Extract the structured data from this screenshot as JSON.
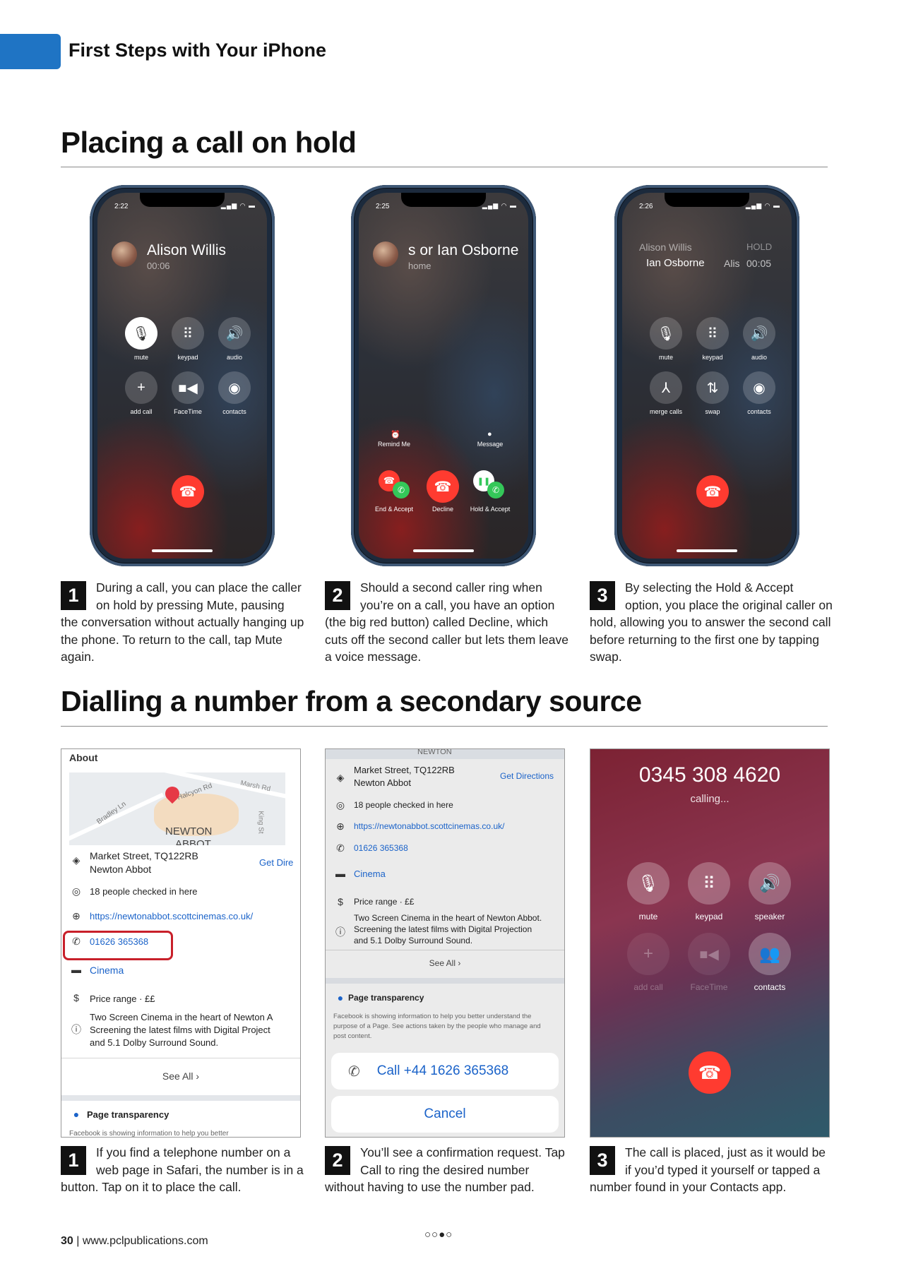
{
  "header": {
    "section_title": "First Steps with Your iPhone"
  },
  "section1": {
    "title": "Placing a call on hold"
  },
  "section2": {
    "title": "Dialling a number from a secondary source"
  },
  "colors": {
    "accent_tab": "#1f74c4",
    "end_call_red": "#ff3b30",
    "accept_green": "#34c759",
    "link_blue": "#1b63c9",
    "highlight_red": "#c8202a"
  },
  "phone1": {
    "time": "2:22",
    "status_icons": "signal wifi battery",
    "caller_name": "Alison Willis",
    "duration": "00:06",
    "buttons": [
      {
        "icon": "mic-off-icon",
        "label": "mute"
      },
      {
        "icon": "keypad-icon",
        "label": "keypad"
      },
      {
        "icon": "speaker-icon",
        "label": "audio"
      },
      {
        "icon": "plus-icon",
        "label": "add call"
      },
      {
        "icon": "video-icon",
        "label": "FaceTime"
      },
      {
        "icon": "contacts-icon",
        "label": "contacts"
      }
    ],
    "end_icon": "end-call-icon"
  },
  "phone2": {
    "time": "2:25",
    "caller_name": "s or Ian Osborne",
    "subtitle": "home",
    "remind_label": "Remind Me",
    "message_label": "Message",
    "end_accept_label": "End & Accept",
    "decline_label": "Decline",
    "hold_accept_label": "Hold & Accept"
  },
  "phone3": {
    "time": "2:26",
    "held_name": "Alison Willis",
    "held_status": "HOLD",
    "active_name": "Ian Osborne",
    "active_short": "Alis",
    "duration": "00:05",
    "buttons": [
      {
        "icon": "mic-off-icon",
        "label": "mute"
      },
      {
        "icon": "keypad-icon",
        "label": "keypad"
      },
      {
        "icon": "speaker-icon",
        "label": "audio"
      },
      {
        "icon": "merge-icon",
        "label": "merge calls"
      },
      {
        "icon": "swap-icon",
        "label": "swap"
      },
      {
        "icon": "contacts-icon",
        "label": "contacts"
      }
    ]
  },
  "steps1": [
    {
      "num": "1",
      "text": "During a call, you can place the caller on hold by pressing Mute, pausing the conversation without actually hanging up the phone. To return to the call, tap Mute again."
    },
    {
      "num": "2",
      "text": "Should a second caller ring when you’re on a call, you have an option (the big red button) called Decline, which cuts off the second caller but lets them leave a voice message."
    },
    {
      "num": "3",
      "text": "By selecting the Hold & Accept option, you place the original caller on hold, allowing you to answer the second call before returning to the first one by tapping swap."
    }
  ],
  "shot1": {
    "about": "About",
    "map_labels": [
      "Bradley Ln",
      "Halcyon Rd",
      "Marsh Rd",
      "NEWTON",
      "ABBOT",
      "King St"
    ],
    "address_line1": "Market Street, TQ122RB",
    "address_line2": "Newton Abbot",
    "directions": "Get Dire",
    "checked_in": "18 people checked in here",
    "website": "https://newtonabbot.scottcinemas.co.uk/",
    "phone": "01626 365368",
    "category": "Cinema",
    "price": "Price range · ££",
    "desc1": "Two Screen Cinema in the heart of Newton A",
    "desc2": "Screening the latest films with Digital Project",
    "desc3": "and 5.1 Dolby Surround Sound.",
    "see_all": "See All",
    "transparency": "Page transparency",
    "cut_text": "Facebook is showing information to help you better"
  },
  "shot2": {
    "map_top": "NEWTON",
    "address_line1": "Market Street, TQ122RB",
    "address_line2": "Newton Abbot",
    "directions": "Get Directions",
    "checked_in": "18 people checked in here",
    "website": "https://newtonabbot.scottcinemas.co.uk/",
    "phone": "01626 365368",
    "category": "Cinema",
    "price": "Price range · ££",
    "desc1": "Two Screen Cinema in the heart of Newton Abbot.",
    "desc2": "Screening the latest films with Digital Projection",
    "desc3": "and 5.1 Dolby Surround Sound.",
    "see_all": "See All",
    "transparency": "Page transparency",
    "transparency_text": "Facebook is showing information to help you better understand the purpose of a Page. See actions taken by the people who manage and post content.",
    "call_button": "Call +44 1626 365368",
    "cancel_button": "Cancel"
  },
  "shot3": {
    "number": "0345 308 4620",
    "status": "calling...",
    "buttons": [
      {
        "icon": "mic-off-icon",
        "label": "mute"
      },
      {
        "icon": "keypad-icon",
        "label": "keypad"
      },
      {
        "icon": "speaker-icon",
        "label": "speaker"
      },
      {
        "icon": "plus-icon",
        "label": "add call"
      },
      {
        "icon": "video-icon",
        "label": "FaceTime"
      },
      {
        "icon": "contacts-icon",
        "label": "contacts"
      }
    ]
  },
  "steps2": [
    {
      "num": "1",
      "text": "If you find a telephone number on a web page in Safari, the number is in a button. Tap on it to place the call."
    },
    {
      "num": "2",
      "text": "You’ll see a confirmation request. Tap Call to ring the desired number without having to use the number pad."
    },
    {
      "num": "3",
      "text": "The call is placed, just as it would be if you’d typed it yourself or tapped a number found in your Contacts app."
    }
  ],
  "pager": "○○●○",
  "footer": {
    "page": "30",
    "separator": "|",
    "url": "www.pclpublications.com"
  }
}
